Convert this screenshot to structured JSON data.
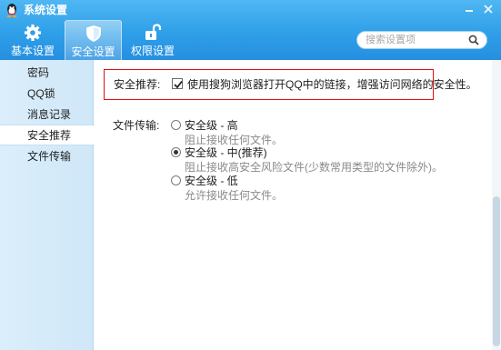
{
  "window": {
    "title": "系统设置"
  },
  "tabs": [
    {
      "label": "基本设置",
      "icon": "gear-icon"
    },
    {
      "label": "安全设置",
      "icon": "shield-icon"
    },
    {
      "label": "权限设置",
      "icon": "unlock-icon"
    }
  ],
  "search": {
    "placeholder": "搜索设置项"
  },
  "sidebar": {
    "items": [
      {
        "label": "密码"
      },
      {
        "label": "QQ锁"
      },
      {
        "label": "消息记录"
      },
      {
        "label": "安全推荐"
      },
      {
        "label": "文件传输"
      }
    ]
  },
  "security_recommend": {
    "label": "安全推荐:",
    "checkbox_text": "使用搜狗浏览器打开QQ中的链接，增强访问网络的安全性。",
    "checked": true
  },
  "file_transfer": {
    "label": "文件传输:",
    "options": [
      {
        "title": "安全级 - 高",
        "desc": "阻止接收任何文件。",
        "selected": false
      },
      {
        "title": "安全级 - 中(推荐)",
        "desc": "阻止接收高安全风险文件(少数常用类型的文件除外)。",
        "selected": true
      },
      {
        "title": "安全级 - 低",
        "desc": "允许接收任何文件。",
        "selected": false
      }
    ]
  },
  "colors": {
    "header": "#2f9fe8",
    "accent_border": "#e01010",
    "sidebar": "#d5ebfa"
  }
}
